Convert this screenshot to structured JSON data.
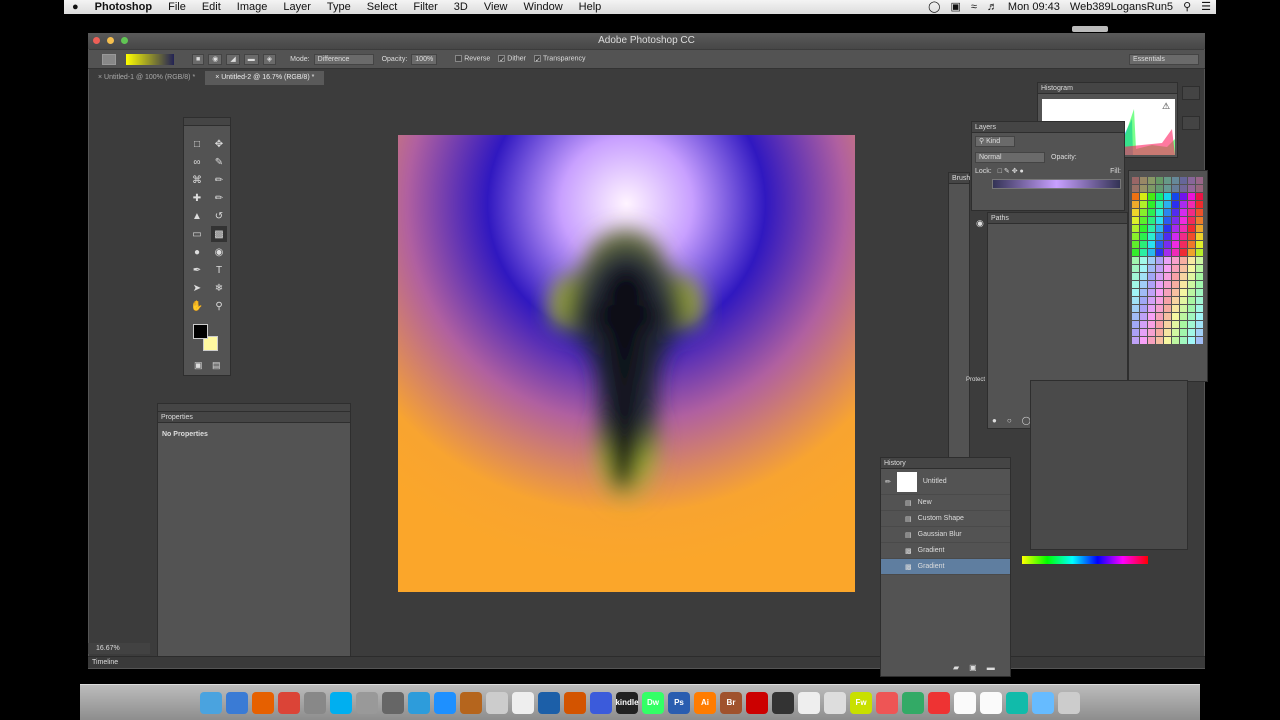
{
  "menubar": {
    "apple": "",
    "app": "Photoshop",
    "items": [
      "File",
      "Edit",
      "Image",
      "Layer",
      "Type",
      "Select",
      "Filter",
      "3D",
      "View",
      "Window",
      "Help"
    ],
    "clock": "Mon 09:43",
    "user": "Web389LogansRun5"
  },
  "window": {
    "title": "Adobe Photoshop CC"
  },
  "options": {
    "mode_label": "Mode:",
    "mode_value": "Difference",
    "opacity_label": "Opacity:",
    "opacity_value": "100%",
    "reverse": "Reverse",
    "dither": "Dither",
    "transparency": "Transparency",
    "workspace": "Essentials"
  },
  "tabs": [
    "Untitled-1 @ 100% (RGB/8) *",
    "Untitled-2 @ 16.7% (RGB/8) *"
  ],
  "panels": {
    "properties": {
      "title": "Properties",
      "body": "No Properties"
    },
    "histogram": {
      "title": "Histogram"
    },
    "layers": {
      "title": "Layers",
      "kind": "Kind",
      "blend": "Normal",
      "opacity": "Opacity:",
      "lock": "Lock:",
      "fill": "Fill:"
    },
    "brush": {
      "title": "Brush"
    },
    "paths": {
      "title": "Paths"
    },
    "protect": "Protect",
    "history": {
      "title": "History",
      "snapshot": "Untitled",
      "steps": [
        "New",
        "Custom Shape",
        "Gaussian Blur",
        "Gradient",
        "Gradient"
      ]
    }
  },
  "status": {
    "zoom": "16.67%",
    "timeline": "Timeline"
  },
  "colors": {
    "foreground": "#000000",
    "background": "#fff9a0"
  },
  "dock_icons": [
    "finder-icon",
    "preview-icon",
    "firefox-icon",
    "chrome-icon",
    "system-icon",
    "skype-icon",
    "photo-icon",
    "utility-icon",
    "appstore-icon",
    "safari-icon",
    "guitar-icon",
    "script-icon",
    "textedit-icon",
    "quicktime-icon",
    "fireworks-icon",
    "compass-icon",
    "kindle-icon",
    "dreamweaver-icon",
    "photoshop-icon",
    "illustrator-icon",
    "bridge-icon",
    "flash-icon",
    "edge-icon",
    "pen-icon",
    "sheep-icon",
    "fw-icon",
    "tool-icon",
    "box-icon",
    "pdf-icon",
    "file-icon",
    "paper-icon",
    "archive-icon",
    "folder-icon",
    "trash-icon"
  ],
  "dock_labels": {
    "kindle": "kindle",
    "dw": "Dw",
    "ps": "Ps",
    "ai": "Ai",
    "br": "Br",
    "fw": "Fw"
  }
}
